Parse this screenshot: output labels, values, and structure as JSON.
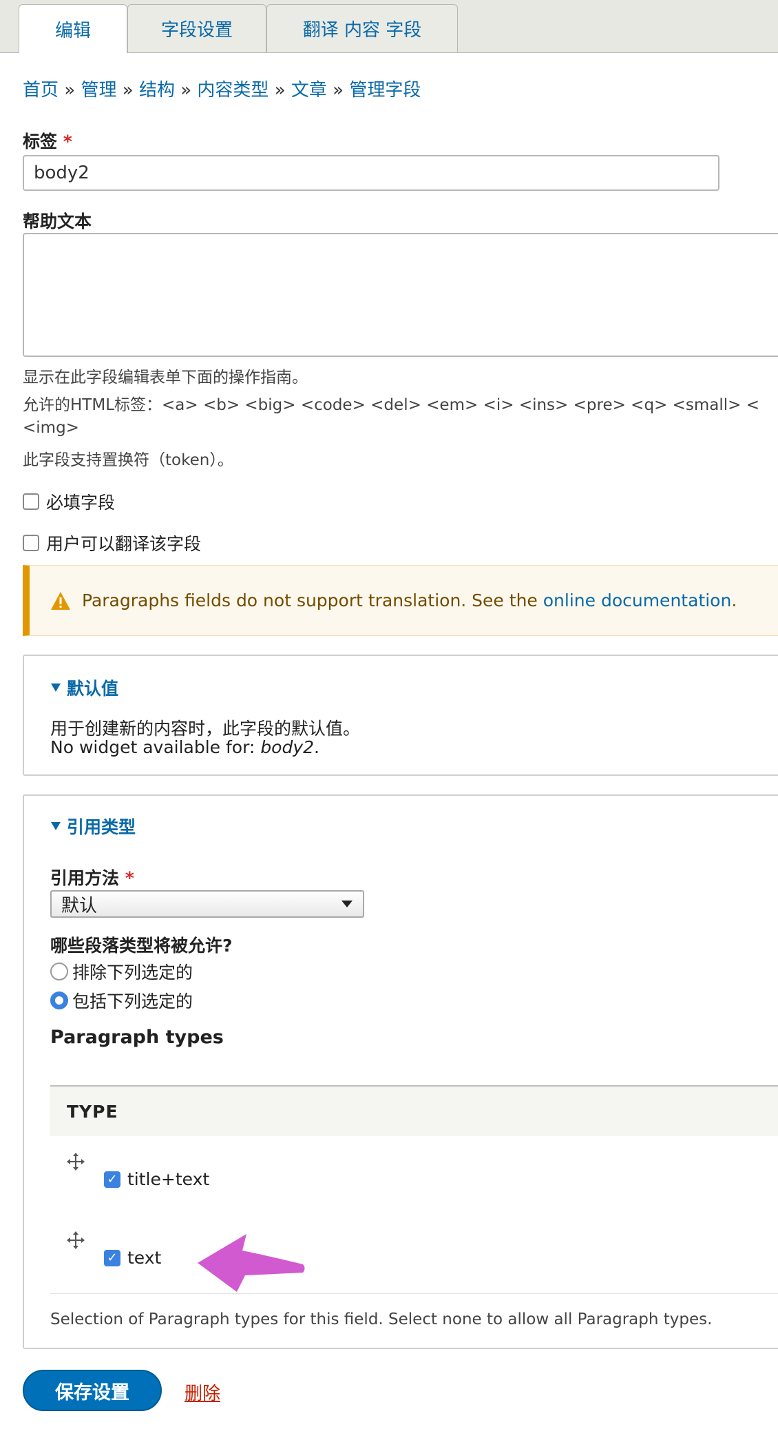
{
  "tabs": [
    {
      "label": "编辑",
      "active": true
    },
    {
      "label": "字段设置",
      "active": false
    },
    {
      "label": "翻译 内容 字段",
      "active": false
    }
  ],
  "breadcrumb": [
    "首页",
    "管理",
    "结构",
    "内容类型",
    "文章",
    "管理字段"
  ],
  "breadcrumb_sep": "»",
  "label_field": {
    "label": "标签",
    "required_mark": "*",
    "value": "body2"
  },
  "help_text": {
    "label": "帮助文本",
    "value": "",
    "desc_1": "显示在此字段编辑表单下面的操作指南。",
    "desc_2": "允许的HTML标签：<a> <b> <big> <code> <del> <em> <i> <ins> <pre> <q> <small> <",
    "desc_3": "<img>",
    "desc_4": "此字段支持置换符（token）。"
  },
  "checkboxes": {
    "required": {
      "label": "必填字段",
      "checked": false
    },
    "translatable": {
      "label": "用户可以翻译该字段",
      "checked": false
    }
  },
  "warning": {
    "text": "Paragraphs fields do not support translation. See the ",
    "link": "online documentation",
    "end": "."
  },
  "default_value": {
    "summary": "默认值",
    "line1": "用于创建新的内容时，此字段的默认值。",
    "line2_prefix": "No widget available for: ",
    "line2_em": "body2",
    "line2_end": "."
  },
  "reference_type": {
    "summary": "引用类型",
    "method_label": "引用方法",
    "required_mark": "*",
    "method_value": "默认",
    "allowed_label": "哪些段落类型将被允许?",
    "radio_exclude": "排除下列选定的",
    "radio_include": "包括下列选定的",
    "selected_radio": "include",
    "types_heading": "Paragraph types",
    "table_header": "TYPE",
    "rows": [
      {
        "label": "title+text",
        "checked": true
      },
      {
        "label": "text",
        "checked": true
      }
    ],
    "table_desc": "Selection of Paragraph types for this field. Select none to allow all Paragraph types."
  },
  "actions": {
    "save": "保存设置",
    "delete": "删除"
  },
  "colors": {
    "link": "#0a6aa8",
    "primary": "#0071b8",
    "danger": "#c72100",
    "warning_border": "#e29700",
    "annotation_arrow": "#d15ad0"
  },
  "icons": {
    "warning": "warning-triangle-icon",
    "drag": "drag-handle-icon",
    "disclosure": "triangle-down-icon"
  }
}
